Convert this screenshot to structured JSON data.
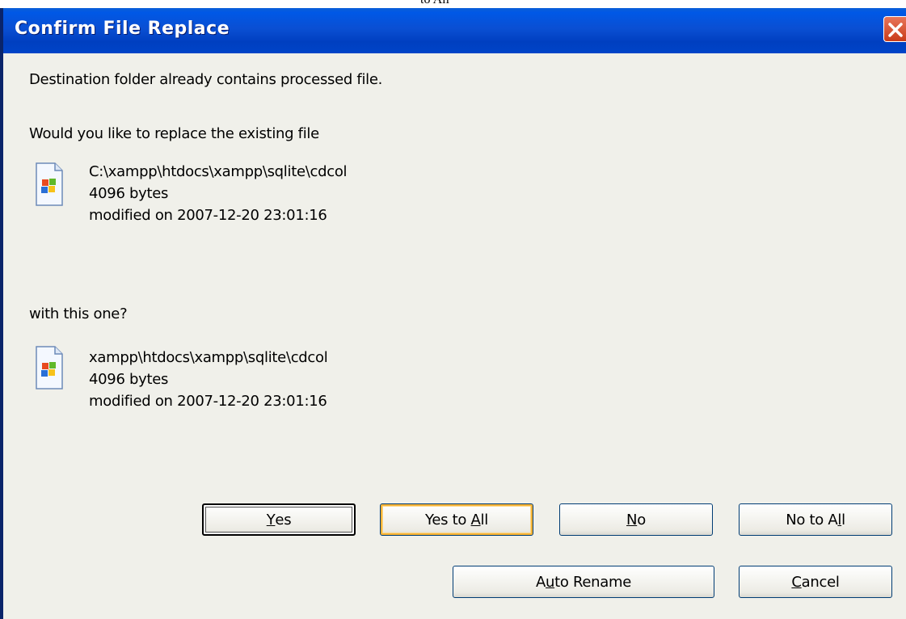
{
  "top_strip": {
    "text": "to All"
  },
  "dialog": {
    "title": "Confirm File Replace",
    "message": "Destination folder already contains processed file.",
    "question": "Would you like to replace the existing file",
    "existing_file": {
      "path": "C:\\xampp\\htdocs\\xampp\\sqlite\\cdcol",
      "size": "4096 bytes",
      "modified": "modified on 2007-12-20 23:01:16",
      "icon": "windows-file-icon"
    },
    "with_text": "with this one?",
    "new_file": {
      "path": "xampp\\htdocs\\xampp\\sqlite\\cdcol",
      "size": "4096 bytes",
      "modified": "modified on 2007-12-20 23:01:16",
      "icon": "windows-file-icon"
    },
    "buttons": {
      "yes": {
        "pre": "",
        "mnemonic": "Y",
        "post": "es"
      },
      "yes_to_all": {
        "pre": "Yes to ",
        "mnemonic": "A",
        "post": "ll"
      },
      "no": {
        "pre": "",
        "mnemonic": "N",
        "post": "o"
      },
      "no_to_all": {
        "pre": "No to A",
        "mnemonic": "l",
        "post": "l"
      },
      "auto_rename": {
        "pre": "A",
        "mnemonic": "u",
        "post": "to Rename"
      },
      "cancel": {
        "pre": "",
        "mnemonic": "C",
        "post": "ancel"
      }
    }
  },
  "colors": {
    "titlebar": "#0a4fd3",
    "dialog_bg": "#f0f0ea",
    "close_button": "#c93c1a",
    "hover_highlight": "#f8b335"
  }
}
